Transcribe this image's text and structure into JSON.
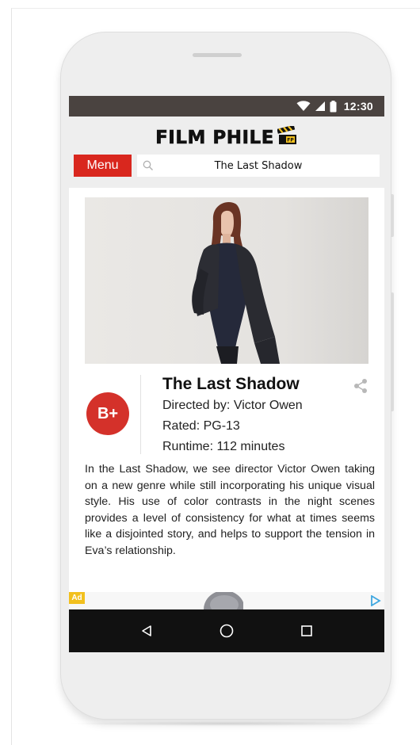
{
  "status_bar": {
    "time": "12:30",
    "icons": [
      "wifi-icon",
      "signal-icon",
      "battery-icon"
    ]
  },
  "header": {
    "logo_text": "FILM PHILE",
    "logo_badge": "FP",
    "logo_icon": "clapperboard-icon",
    "menu_label": "Menu",
    "search_value": "The Last Shadow",
    "search_icon": "search-icon"
  },
  "movie": {
    "grade": "B+",
    "title": "The Last Shadow",
    "director": "Directed by: Victor Owen",
    "rated": "Rated: PG-13",
    "runtime": "Runtime: 112 minutes",
    "share_icon": "share-icon",
    "review": "In the Last Shadow, we see director Victor Owen taking on a new genre while still incorporating his unique visual style. His use of color contrasts in the night scenes provides a level of consistency for what at times seems like a disjointed story, and helps to support the tension in Eva’s relationship."
  },
  "ad": {
    "label": "Ad",
    "icon": "ad-choices-icon"
  },
  "nav": {
    "icons": [
      "back-icon",
      "home-icon",
      "recents-icon"
    ]
  },
  "colors": {
    "accent_red": "#d9271e",
    "grade_red": "#d4312a",
    "status_bar": "#4a4340",
    "nav_bar": "#111111",
    "ad_yellow": "#f2c01e",
    "phone_body": "#eeeeee"
  }
}
